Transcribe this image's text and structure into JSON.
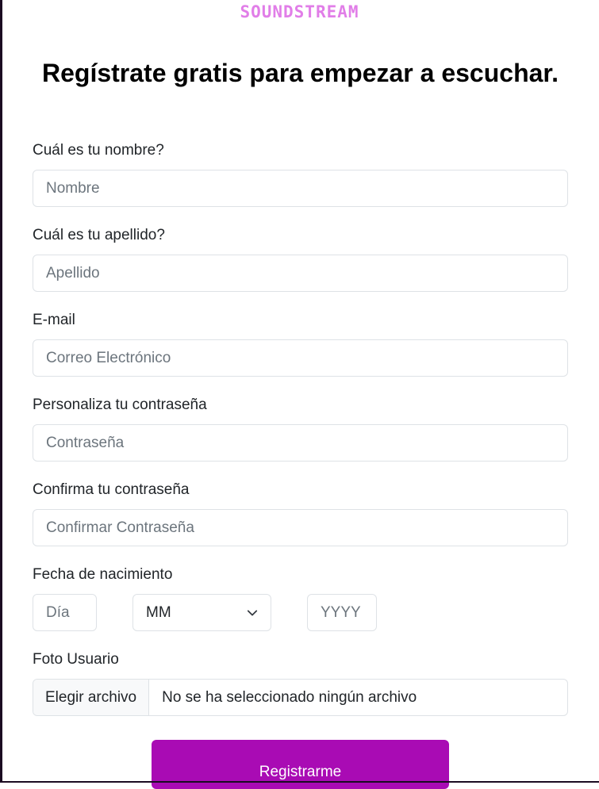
{
  "brand": {
    "logo_text": "SOUNDSTREAM",
    "logo_color": "#e17ee8"
  },
  "page": {
    "title": "Regístrate gratis para empezar a escuchar."
  },
  "form": {
    "first_name": {
      "label": "Cuál es tu nombre?",
      "placeholder": "Nombre"
    },
    "last_name": {
      "label": "Cuál es tu apellido?",
      "placeholder": "Apellido"
    },
    "email": {
      "label": "E-mail",
      "placeholder": "Correo Electrónico"
    },
    "password": {
      "label": "Personaliza tu contraseña",
      "placeholder": "Contraseña"
    },
    "confirm_password": {
      "label": "Confirma tu contraseña",
      "placeholder": "Confirmar Contraseña"
    },
    "birth_date": {
      "label": "Fecha de nacimiento",
      "day_placeholder": "Día",
      "month_value": "MM",
      "year_placeholder": "YYYY"
    },
    "photo": {
      "label": "Foto Usuario",
      "button_label": "Elegir archivo",
      "status": "No se ha seleccionado ningún archivo"
    },
    "submit_label": "Registrarme",
    "submit_color": "#a90bb4"
  },
  "icons": {
    "month_select": "chevron-down-icon"
  }
}
